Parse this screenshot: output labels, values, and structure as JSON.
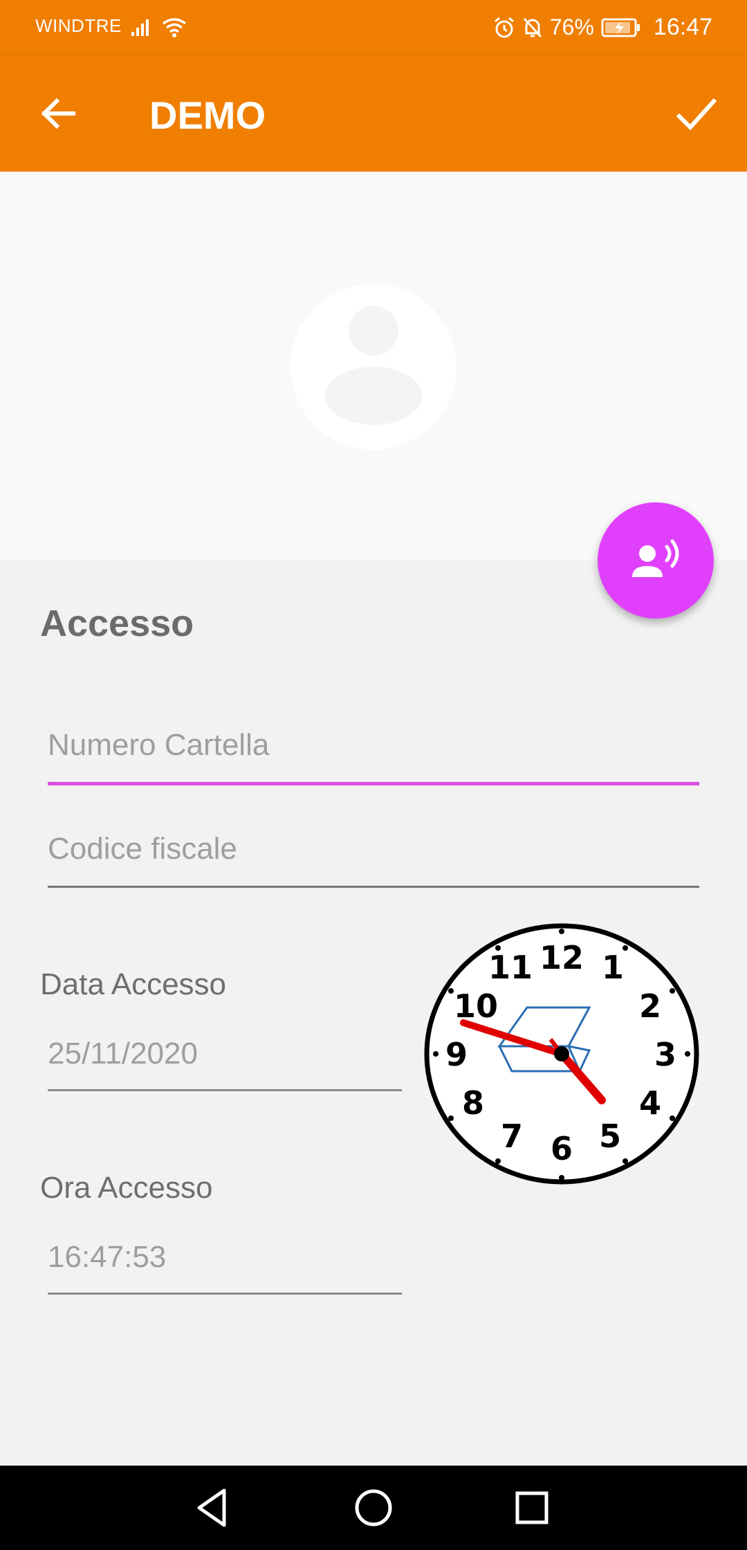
{
  "status_bar": {
    "carrier": "WINDTRE",
    "battery_percent": "76%",
    "time": "16:47",
    "icons": [
      "signal-icon",
      "wifi-icon",
      "alarm-icon",
      "bell-off-icon",
      "battery-charging-icon"
    ]
  },
  "app_bar": {
    "title": "DEMO",
    "back_icon": "arrow-left-icon",
    "confirm_icon": "check-icon",
    "background_color": "#f07e00"
  },
  "profile": {
    "avatar_icon": "account-circle-icon"
  },
  "fab": {
    "icon": "record-voice-icon",
    "color": "#e040fb"
  },
  "form": {
    "section_title": "Accesso",
    "numero_cartella": {
      "placeholder": "Numero Cartella",
      "value": "",
      "focused": true,
      "accent_color": "#d84ee6"
    },
    "codice_fiscale": {
      "placeholder": "Codice fiscale",
      "value": ""
    },
    "data_accesso": {
      "label": "Data Accesso",
      "value": "25/11/2020"
    },
    "ora_accesso": {
      "label": "Ora Accesso",
      "value": "16:47:53"
    }
  },
  "clock_widget": {
    "numbers": [
      "12",
      "1",
      "2",
      "3",
      "4",
      "5",
      "6",
      "7",
      "8",
      "9",
      "10",
      "11"
    ],
    "time": "16:47:53"
  },
  "nav_bar": {
    "buttons": [
      "back-triangle-icon",
      "home-circle-icon",
      "recents-square-icon"
    ]
  }
}
